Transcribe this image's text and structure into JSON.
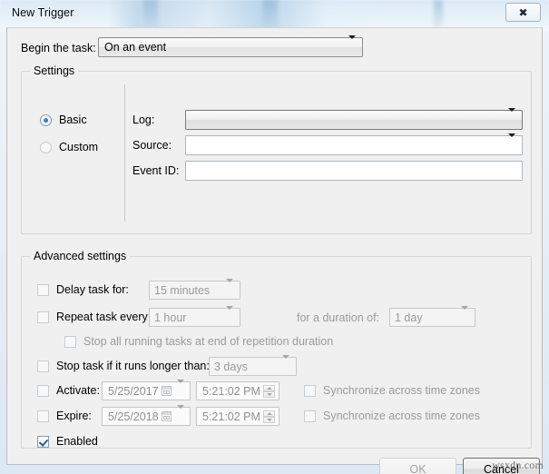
{
  "window": {
    "title": "New Trigger",
    "close_icon": "close-icon"
  },
  "begin": {
    "label": "Begin the task:",
    "value": "On an event"
  },
  "settings": {
    "group_title": "Settings",
    "mode_basic": "Basic",
    "mode_custom": "Custom",
    "selected_mode": "Basic",
    "fields": [
      {
        "label": "Log:",
        "value": ""
      },
      {
        "label": "Source:",
        "value": ""
      },
      {
        "label": "Event ID:",
        "value": ""
      }
    ]
  },
  "advanced": {
    "group_title": "Advanced settings",
    "delay_task": {
      "label": "Delay task for:",
      "value": "15 minutes",
      "checked": false
    },
    "repeat_task": {
      "label": "Repeat task every:",
      "value": "1 hour",
      "checked": false
    },
    "duration": {
      "label": "for a duration of:",
      "value": "1 day"
    },
    "stop_all_running": {
      "label": "Stop all running tasks at end of repetition duration",
      "checked": false
    },
    "stop_task_longer": {
      "label": "Stop task if it runs longer than:",
      "value": "3 days",
      "checked": false
    },
    "activate": {
      "label": "Activate:",
      "date": "5/25/2017",
      "time": "5:21:02 PM",
      "sync_label": "Synchronize across time zones",
      "checked": false,
      "sync_checked": false
    },
    "expire": {
      "label": "Expire:",
      "date": "5/25/2018",
      "time": "5:21:02 PM",
      "sync_label": "Synchronize across time zones",
      "checked": false,
      "sync_checked": false
    },
    "enabled": {
      "label": "Enabled",
      "checked": true
    }
  },
  "footer": {
    "ok_label": "OK",
    "cancel_label": "Cancel",
    "watermark": "wsxdn.com"
  },
  "colors": {
    "dialog_bg": "#f0f0f0",
    "accent_check": "#2a5f96",
    "radio_accent": "#1f6fb5",
    "disabled_text": "#9a9a9a"
  }
}
